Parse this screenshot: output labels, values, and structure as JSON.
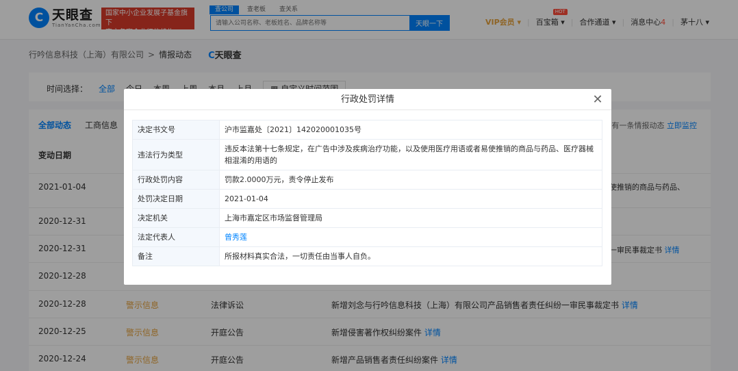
{
  "header": {
    "logo_text": "天眼查",
    "logo_en": "TianYanCha.com",
    "banner_line1": "国家中小企业发展子基金旗下",
    "banner_line2": "官方备案企业征信机构",
    "search_tabs": [
      "查公司",
      "查老板",
      "查关系"
    ],
    "search_placeholder": "请输入公司名称、老板姓名、品牌名称等",
    "search_button": "天眼一下",
    "nav": {
      "vip": "VIP会员",
      "baobao": "百宝箱",
      "hot": "HOT",
      "cooperation": "合作通道",
      "messages": "消息中心",
      "messages_count": "4",
      "user": "茅十八"
    }
  },
  "breadcrumb": {
    "company": "行吟信息科技（上海）有限公司",
    "separator": ">",
    "page": "情报动态",
    "logo": "天眼查"
  },
  "filter": {
    "label": "时间选择：",
    "options": [
      "全部",
      "今日",
      "本周",
      "上周",
      "本月",
      "上月"
    ],
    "custom": "自定义时间范围"
  },
  "main": {
    "tabs": [
      "全部动态",
      "工商信息"
    ],
    "right_text": "有一条情报动态",
    "right_link": "立即监控",
    "column_date": "变动日期",
    "rows": [
      {
        "date": "2021-01-04",
        "type": "",
        "category": "",
        "content": ""
      },
      {
        "date": "2020-12-31",
        "type": "",
        "category": "",
        "content": ""
      },
      {
        "date": "2020-12-31",
        "type": "",
        "category": "",
        "content": ""
      },
      {
        "date": "2020-12-28",
        "type": "",
        "category": "",
        "content": ""
      },
      {
        "date": "2020-12-28",
        "type": "警示信息",
        "category": "法律诉讼",
        "content": "新增刘念与行吟信息科技（上海）有限公司产品销售者责任纠纷一审民事裁定书",
        "detail": "详情"
      },
      {
        "date": "2020-12-25",
        "type": "警示信息",
        "category": "开庭公告",
        "content": "新增侵害著作权纠纷案件",
        "detail": "详情"
      },
      {
        "date": "2020-12-24",
        "type": "警示信息",
        "category": "开庭公告",
        "content": "新增产品销售者责任纠纷案件",
        "detail": "详情"
      }
    ],
    "side_fragments": {
      "row1": "使推销的商品与药品、",
      "row3": "一审民事裁定书",
      "row3_detail": "详情"
    }
  },
  "modal": {
    "title": "行政处罚详情",
    "close": "✕",
    "rows": [
      {
        "key": "决定书文号",
        "value": "沪市监嘉处〔2021〕142020001035号"
      },
      {
        "key": "违法行为类型",
        "value": "违反本法第十七条规定，在广告中涉及疾病治疗功能，以及使用医疗用语或者易使推销的商品与药品、医疗器械相混淆的用语的"
      },
      {
        "key": "行政处罚内容",
        "value": "罚款2.0000万元，责令停止发布"
      },
      {
        "key": "处罚决定日期",
        "value": "2021-01-04"
      },
      {
        "key": "决定机关",
        "value": "上海市嘉定区市场监督管理局"
      },
      {
        "key": "法定代表人",
        "value": "曾秀莲"
      },
      {
        "key": "备注",
        "value": "所报材料真实合法，一切责任由当事人自负。"
      }
    ]
  }
}
